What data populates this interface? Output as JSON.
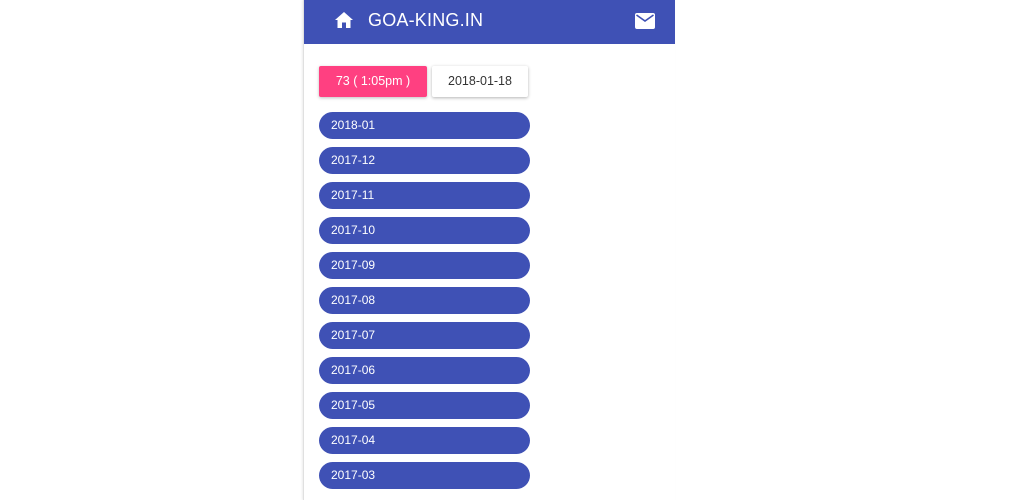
{
  "header": {
    "title": "GOA-KING.IN",
    "home_icon": "home-icon",
    "mail_icon": "mail-icon",
    "bar_color": "#3f51b5"
  },
  "result": {
    "value": "73 ( 1:05pm )",
    "date": "2018-01-18",
    "accent_color": "#ff4081"
  },
  "months": [
    {
      "label": "2018-01"
    },
    {
      "label": "2017-12"
    },
    {
      "label": "2017-11"
    },
    {
      "label": "2017-10"
    },
    {
      "label": "2017-09"
    },
    {
      "label": "2017-08"
    },
    {
      "label": "2017-07"
    },
    {
      "label": "2017-06"
    },
    {
      "label": "2017-05"
    },
    {
      "label": "2017-04"
    },
    {
      "label": "2017-03"
    }
  ]
}
